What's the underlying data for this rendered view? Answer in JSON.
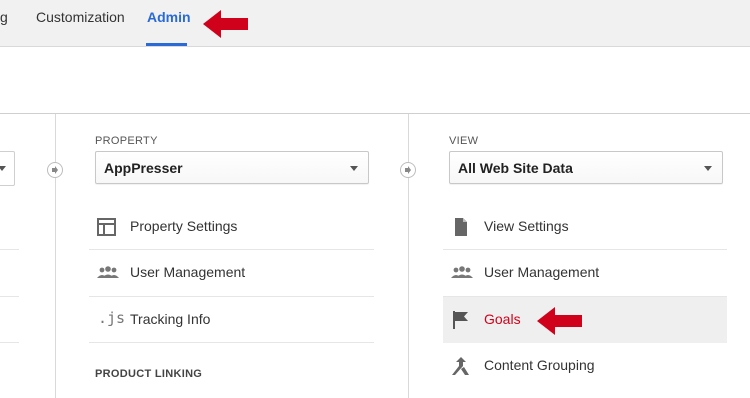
{
  "top_nav": {
    "tabs": [
      {
        "label": "g"
      },
      {
        "label": "Customization"
      },
      {
        "label": "Admin"
      }
    ]
  },
  "property": {
    "heading": "PROPERTY",
    "selected": "AppPresser",
    "items": [
      {
        "label": "Property Settings",
        "icon": "property-settings-icon"
      },
      {
        "label": "User Management",
        "icon": "users-icon"
      },
      {
        "label": "Tracking Info",
        "icon": "js-icon",
        "icon_text": ".js"
      }
    ],
    "section_heading": "PRODUCT LINKING"
  },
  "view": {
    "heading": "VIEW",
    "selected": "All Web Site Data",
    "items": [
      {
        "label": "View Settings",
        "icon": "document-icon"
      },
      {
        "label": "User Management",
        "icon": "users-icon"
      },
      {
        "label": "Goals",
        "icon": "flag-icon"
      },
      {
        "label": "Content Grouping",
        "icon": "content-grouping-icon"
      }
    ]
  },
  "colors": {
    "accent_blue": "#2a6ad6",
    "annotation_red": "#d0021b",
    "active_row_bg": "#efefef"
  }
}
